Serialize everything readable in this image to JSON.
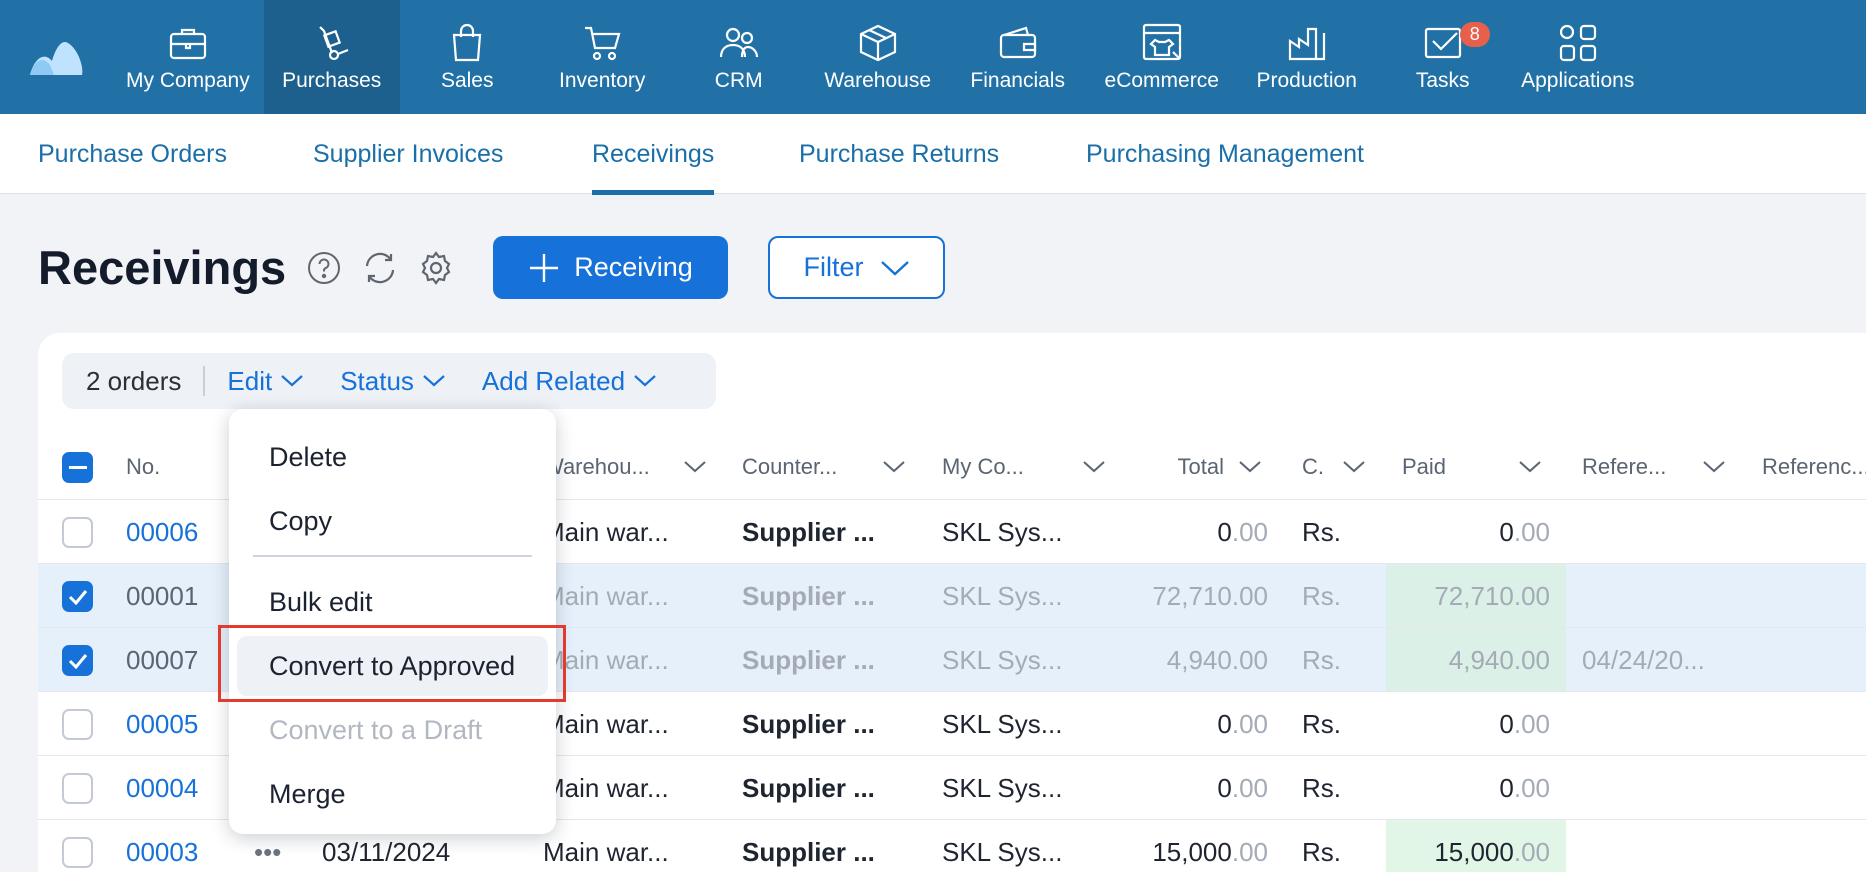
{
  "topnav": {
    "items": [
      {
        "label": "My Company",
        "icon": "briefcase-icon"
      },
      {
        "label": "Purchases",
        "icon": "dolly-icon",
        "active": true
      },
      {
        "label": "Sales",
        "icon": "shopping-bag-icon"
      },
      {
        "label": "Inventory",
        "icon": "cart-icon"
      },
      {
        "label": "CRM",
        "icon": "people-icon"
      },
      {
        "label": "Warehouse",
        "icon": "box-icon"
      },
      {
        "label": "Financials",
        "icon": "wallet-icon"
      },
      {
        "label": "eCommerce",
        "icon": "storefront-icon"
      },
      {
        "label": "Production",
        "icon": "factory-icon"
      },
      {
        "label": "Tasks",
        "icon": "check-mail-icon",
        "badge": "8"
      },
      {
        "label": "Applications",
        "icon": "apps-grid-icon"
      }
    ]
  },
  "subnav": {
    "tabs": [
      {
        "label": "Purchase Orders"
      },
      {
        "label": "Supplier Invoices"
      },
      {
        "label": "Receivings",
        "active": true
      },
      {
        "label": "Purchase Returns"
      },
      {
        "label": "Purchasing Management"
      }
    ]
  },
  "page": {
    "title": "Receivings",
    "add_button": "Receiving",
    "filter_button": "Filter"
  },
  "toolbar": {
    "count": "2 orders",
    "edit": "Edit",
    "status": "Status",
    "add_related": "Add Related"
  },
  "table": {
    "headers": [
      "No.",
      "Warehou...",
      "Counter...",
      "My Co...",
      "Total",
      "C.",
      "Paid",
      "Refere...",
      "Referenc..."
    ],
    "rows": [
      {
        "no": "00006",
        "selected": false,
        "date": "",
        "warehouse": "Main war...",
        "counterparty": "Supplier ...",
        "company": "SKL Sys...",
        "total_int": "0",
        "total_dec": ".00",
        "currency": "Rs.",
        "paid_int": "0",
        "paid_dec": ".00",
        "reference": ""
      },
      {
        "no": "00001",
        "selected": true,
        "date": "",
        "warehouse": "Main war...",
        "counterparty": "Supplier ...",
        "company": "SKL Sys...",
        "total_int": "72,710",
        "total_dec": ".00",
        "currency": "Rs.",
        "paid_int": "72,710",
        "paid_dec": ".00",
        "reference": ""
      },
      {
        "no": "00007",
        "selected": true,
        "date": "",
        "warehouse": "Main war...",
        "counterparty": "Supplier ...",
        "company": "SKL Sys...",
        "total_int": "4,940",
        "total_dec": ".00",
        "currency": "Rs.",
        "paid_int": "4,940",
        "paid_dec": ".00",
        "reference": "04/24/20..."
      },
      {
        "no": "00005",
        "selected": false,
        "date": "",
        "warehouse": "Main war...",
        "counterparty": "Supplier ...",
        "company": "SKL Sys...",
        "total_int": "0",
        "total_dec": ".00",
        "currency": "Rs.",
        "paid_int": "0",
        "paid_dec": ".00",
        "reference": ""
      },
      {
        "no": "00004",
        "selected": false,
        "date": "",
        "warehouse": "Main war...",
        "counterparty": "Supplier ...",
        "company": "SKL Sys...",
        "total_int": "0",
        "total_dec": ".00",
        "currency": "Rs.",
        "paid_int": "0",
        "paid_dec": ".00",
        "reference": ""
      },
      {
        "no": "00003",
        "selected": false,
        "date": "03/11/2024",
        "warehouse": "Main war...",
        "counterparty": "Supplier ...",
        "company": "SKL Sys...",
        "total_int": "15,000",
        "total_dec": ".00",
        "currency": "Rs.",
        "paid_int": "15,000",
        "paid_dec": ".00",
        "reference": ""
      }
    ]
  },
  "edit_menu": {
    "items": [
      "Delete",
      "Copy",
      "Bulk edit",
      "Convert to Approved",
      "Convert to a Draft",
      "Merge"
    ],
    "hovered": "Convert to Approved",
    "disabled": "Convert to a Draft"
  },
  "colors": {
    "nav_bg": "#2271a6",
    "accent": "#1671d9",
    "highlight_box": "#e23a2c",
    "paid_bg": "#e2f6e8",
    "selected_row": "#e6f0fb"
  }
}
